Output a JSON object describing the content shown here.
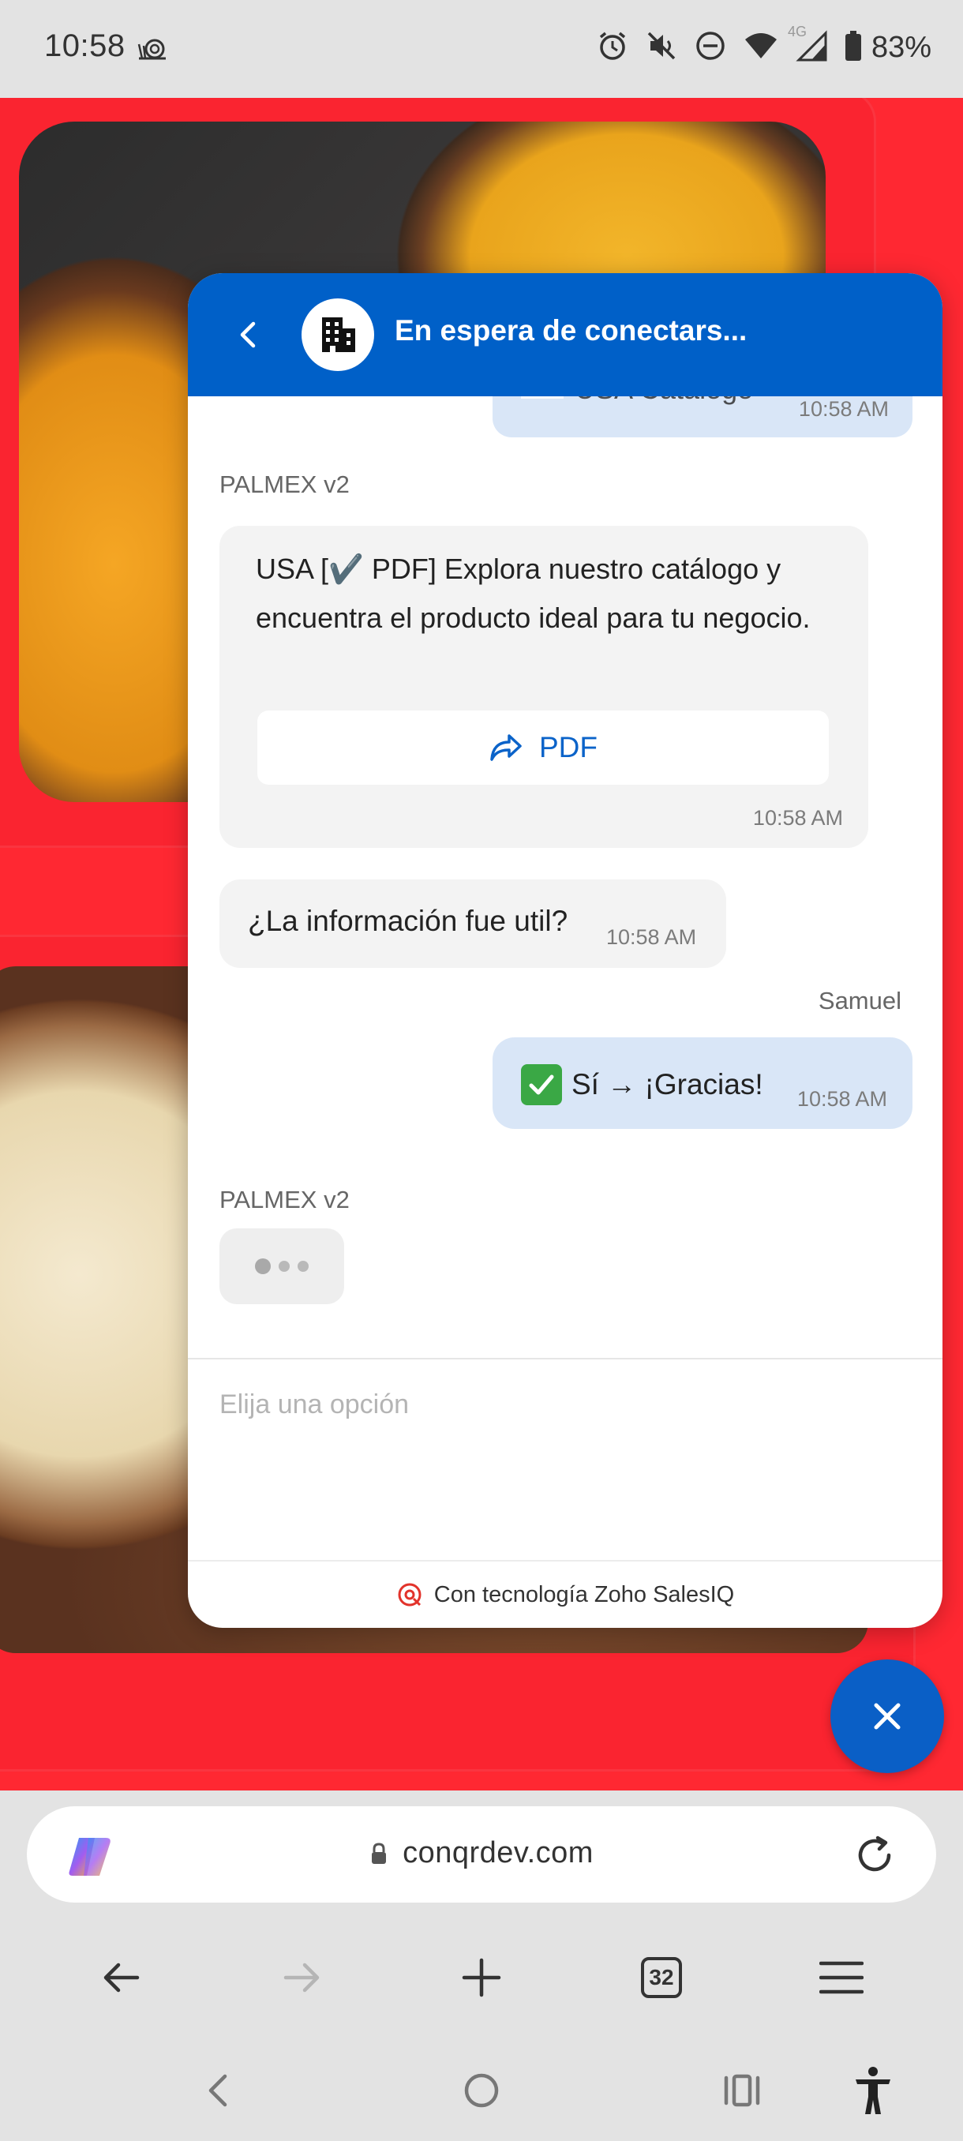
{
  "status_bar": {
    "time": "10:58",
    "battery": "83%",
    "network": "4G",
    "icons": [
      "snail-icon",
      "alarm-icon",
      "mute-icon",
      "do-not-disturb-icon",
      "wifi-icon",
      "signal-icon",
      "battery-icon"
    ]
  },
  "chat": {
    "header_title": "En espera de conectars...",
    "partial_message": {
      "text": "USA Catálogo",
      "time": "10:58 AM"
    },
    "messages": [
      {
        "sender": "PALMEX v2",
        "text": "USA [✔️ PDF] Explora nuestro catálogo y encuentra el producto ideal para tu negocio.",
        "button_label": "PDF",
        "time": "10:58 AM"
      },
      {
        "text": "¿La información fue util?",
        "time": "10:58 AM"
      },
      {
        "sender": "Samuel",
        "text": "Sí → ¡Gracias!",
        "time": "10:58 AM"
      },
      {
        "sender": "PALMEX v2",
        "typing": true
      }
    ],
    "input_placeholder": "Elija una opción",
    "powered_by": "Con tecnología Zoho SalesIQ"
  },
  "browser": {
    "url": "conqrdev.com",
    "tab_count": "32"
  },
  "colors": {
    "brand_blue": "#0060c8",
    "page_red": "#ff2832",
    "user_bubble": "#d9e6f7",
    "bot_bubble": "#f3f3f3"
  }
}
